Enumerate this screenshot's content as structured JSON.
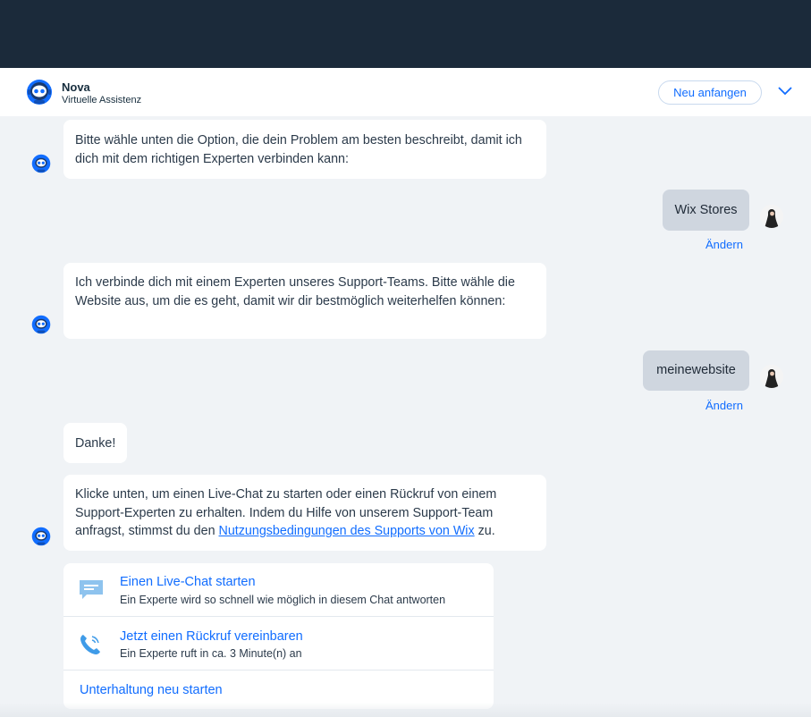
{
  "header": {
    "bot_name": "Nova",
    "bot_subtitle": "Virtuelle Assistenz",
    "restart_button": "Neu anfangen",
    "expand_icon": "chevron-down-icon"
  },
  "messages": {
    "bot1": "Bitte wähle unten die Option, die dein Problem am besten beschreibt, damit ich dich mit dem richtigen Experten verbinden kann:",
    "user1": "Wix Stores",
    "change1": "Ändern",
    "bot2": "Ich verbinde dich mit einem Experten unseres Support-Teams. Bitte wähle die Website aus, um die es geht, damit wir dir bestmöglich weiterhelfen können:",
    "user2": "meinewebsite",
    "change2": "Ändern",
    "bot3": "Danke!",
    "bot4_part1": "Klicke unten, um einen Live-Chat zu starten oder einen Rückruf von einem Support-Experten zu erhalten. Indem du Hilfe von unserem Support-Team anfragst, stimmst du den ",
    "bot4_link": "Nutzungsbedingungen des Supports von Wix",
    "bot4_part2": " zu."
  },
  "actions": {
    "live_chat_title": "Einen Live-Chat starten",
    "live_chat_desc": "Ein Experte wird so schnell wie möglich in diesem Chat antworten",
    "callback_title": "Jetzt einen Rückruf vereinbaren",
    "callback_desc": "Ein Experte ruft in ca. 3 Minute(n) an",
    "restart_link": "Unterhaltung neu starten"
  },
  "colors": {
    "topbar": "#1b2a3a",
    "accent": "#116dff",
    "background": "#f0f3f6",
    "user_bubble": "#cfd6df"
  }
}
